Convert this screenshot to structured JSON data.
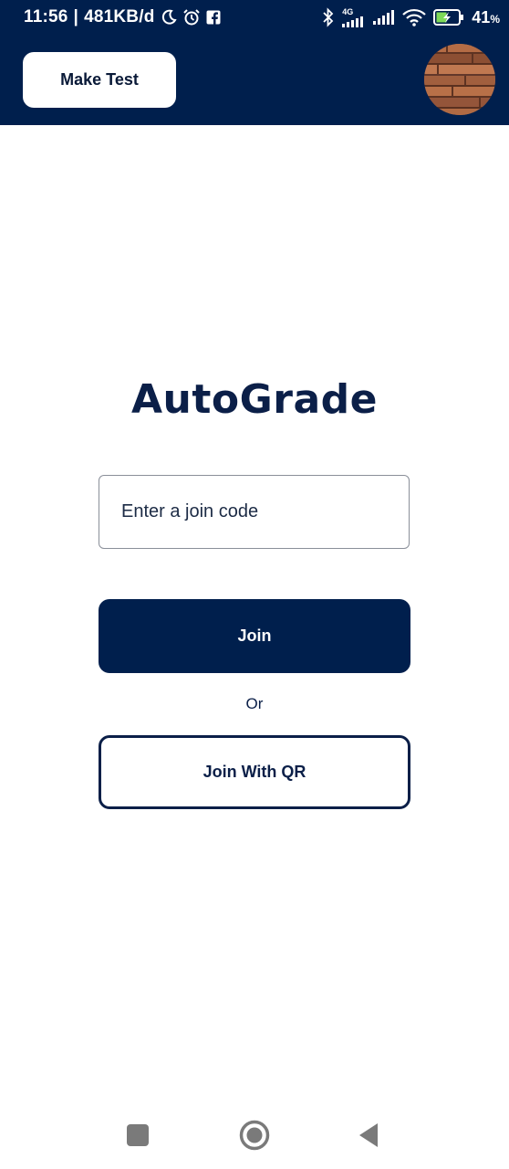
{
  "status_bar": {
    "time": "11:56",
    "separator": "|",
    "network_speed": "481KB/d",
    "network_type": "4G",
    "battery_percent": "41",
    "battery_symbol": "%",
    "icons": [
      "moon-icon",
      "alarm-icon",
      "facebook-icon",
      "bluetooth-icon",
      "signal-4g-icon",
      "signal-icon",
      "wifi-icon",
      "battery-charging-icon"
    ]
  },
  "app_bar": {
    "make_test_label": "Make Test",
    "avatar": "wood-texture-avatar"
  },
  "main": {
    "title": "AutoGrade",
    "join_code_placeholder": "Enter a join code",
    "join_code_value": "",
    "join_label": "Join",
    "or_label": "Or",
    "join_qr_label": "Join With QR"
  },
  "nav_bar": {
    "icons": [
      "recent-apps-icon",
      "home-icon",
      "back-icon"
    ]
  },
  "colors": {
    "primary": "#001f4d",
    "text_dark": "#0b1f48",
    "background": "#ffffff",
    "input_border": "#8a8f99"
  }
}
